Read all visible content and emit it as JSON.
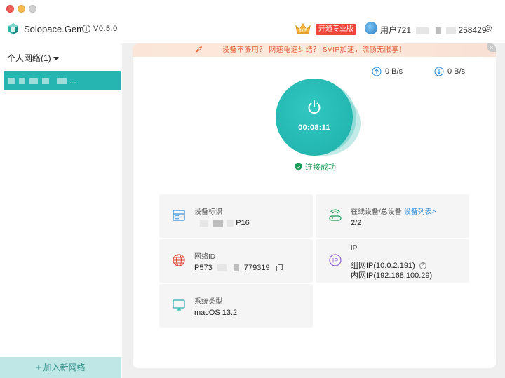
{
  "app": {
    "name": "Solopace.Gem",
    "version": "V0.5.0",
    "pro_button": "开通专业版",
    "user_prefix": "用户721",
    "user_suffix": "258429"
  },
  "sidebar": {
    "group_label": "个人网络(1)",
    "network_item_suffix": "...",
    "add_network_label": "加入新网络"
  },
  "banner": {
    "text": "设备不够用？ 网速龟速纠结？ SVIP加速，流畅无限享！",
    "close": "×"
  },
  "speeds": {
    "upload": "0 B/s",
    "download": "0 B/s"
  },
  "connection": {
    "timer": "00:08:11",
    "status": "连接成功"
  },
  "tiles": {
    "device_id": {
      "label": "设备标识",
      "prefix": "",
      "suffix": "P16"
    },
    "online_devices": {
      "label": "在线设备/总设备",
      "link": "设备列表>",
      "value": "2/2"
    },
    "network_id": {
      "label": "网络ID",
      "prefix": "P573",
      "suffix": "779319"
    },
    "ip": {
      "label": "IP",
      "group_ip": "组网IP(10.0.2.191)",
      "lan_ip": "内网IP(192.168.100.29)"
    },
    "system_type": {
      "label": "系统类型",
      "value": "macOS 13.2"
    }
  },
  "colors": {
    "accent": "#26b5b0",
    "success": "#1a9b57",
    "banner_text": "#e05a33",
    "link": "#2f8fe0",
    "pro_button": "#f0463a"
  },
  "icons": [
    "app-logo-icon",
    "info-icon",
    "crown-icon",
    "avatar",
    "gear-icon",
    "caret-down-icon",
    "plus-icon",
    "rocket-icon",
    "close-icon",
    "upload-arrow-icon",
    "download-arrow-icon",
    "power-icon",
    "shield-check-icon",
    "server-icon",
    "router-icon",
    "globe-icon",
    "ip-icon",
    "monitor-icon",
    "copy-icon",
    "help-icon"
  ]
}
